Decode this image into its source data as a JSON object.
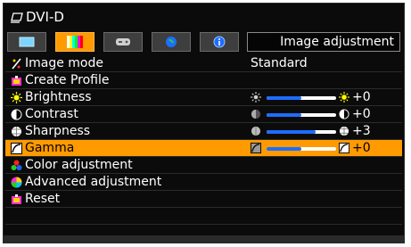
{
  "header": {
    "source": "DVI-D"
  },
  "tabs": [
    {
      "icon": "screen-icon",
      "active": false
    },
    {
      "icon": "color-bars-icon",
      "active": true
    },
    {
      "icon": "gamepad-icon",
      "active": false
    },
    {
      "icon": "globe-icon",
      "active": false
    },
    {
      "icon": "info-icon",
      "active": false
    }
  ],
  "tab_title": "Image adjustment",
  "menu": {
    "image_mode": {
      "label": "Image mode",
      "value": "Standard"
    },
    "create_profile": {
      "label": "Create Profile"
    },
    "brightness": {
      "label": "Brightness",
      "value": "+0",
      "level": 0.5
    },
    "contrast": {
      "label": "Contrast",
      "value": "+0",
      "level": 0.5
    },
    "sharpness": {
      "label": "Sharpness",
      "value": "+3",
      "level": 0.7
    },
    "gamma": {
      "label": "Gamma",
      "value": "+0",
      "level": 0.5
    },
    "color_adjustment": {
      "label": "Color adjustment"
    },
    "advanced_adjustment": {
      "label": "Advanced adjustment"
    },
    "reset": {
      "label": "Reset"
    }
  },
  "colors": {
    "accent": "#ff9a00",
    "slider_fill": "#1e6dff",
    "background": "#0b0b0b"
  }
}
